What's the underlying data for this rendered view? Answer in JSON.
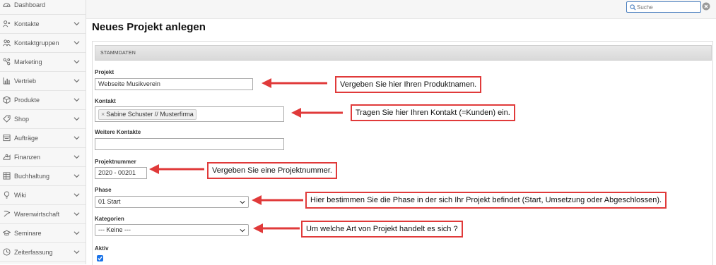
{
  "sidebar": {
    "items": [
      {
        "label": "Dashboard",
        "icon": "dashboard-icon",
        "has_chevron": false
      },
      {
        "label": "Kontakte",
        "icon": "contacts-icon",
        "has_chevron": true
      },
      {
        "label": "Kontaktgruppen",
        "icon": "contact-groups-icon",
        "has_chevron": true
      },
      {
        "label": "Marketing",
        "icon": "marketing-icon",
        "has_chevron": true
      },
      {
        "label": "Vertrieb",
        "icon": "sales-chart-icon",
        "has_chevron": true
      },
      {
        "label": "Produkte",
        "icon": "box-icon",
        "has_chevron": true
      },
      {
        "label": "Shop",
        "icon": "tag-icon",
        "has_chevron": true
      },
      {
        "label": "Aufträge",
        "icon": "orders-icon",
        "has_chevron": true
      },
      {
        "label": "Finanzen",
        "icon": "finance-icon",
        "has_chevron": true
      },
      {
        "label": "Buchhaltung",
        "icon": "ledger-icon",
        "has_chevron": true
      },
      {
        "label": "Wiki",
        "icon": "lightbulb-icon",
        "has_chevron": true
      },
      {
        "label": "Warenwirtschaft",
        "icon": "inventory-icon",
        "has_chevron": true
      },
      {
        "label": "Seminare",
        "icon": "graduation-cap-icon",
        "has_chevron": true
      },
      {
        "label": "Zeiterfassung",
        "icon": "clock-icon",
        "has_chevron": true
      }
    ]
  },
  "topbar": {
    "search_placeholder": "Suche"
  },
  "page": {
    "title": "Neues Projekt anlegen",
    "section_title": "STAMMDATEN"
  },
  "form": {
    "projekt_label": "Projekt",
    "projekt_value": "Webseite Musikverein",
    "kontakt_label": "Kontakt",
    "kontakt_tag": "Sabine Schuster // Musterfirma",
    "weitere_label": "Weitere Kontakte",
    "weitere_value": "",
    "nummer_label": "Projektnummer",
    "nummer_value": "2020 - 00201",
    "phase_label": "Phase",
    "phase_value": "01 Start",
    "kategorien_label": "Kategorien",
    "kategorien_value": "--- Keine ---",
    "aktiv_label": "Aktiv",
    "aktiv_checked": true
  },
  "annotations": {
    "a1": "Vergeben Sie hier Ihren Produktnamen.",
    "a2": "Tragen Sie hier Ihren Kontakt (=Kunden) ein.",
    "a3": "Vergeben Sie eine Projektnummer.",
    "a4": "Hier bestimmen Sie die Phase in der sich Ihr Projekt befindet (Start, Umsetzung oder Abgeschlossen).",
    "a5": "Um welche Art von Projekt handelt es sich ?"
  },
  "colors": {
    "annotation_red": "#e03a3a",
    "checkbox_blue": "#1a73e8",
    "search_border": "#4a7fbf"
  }
}
